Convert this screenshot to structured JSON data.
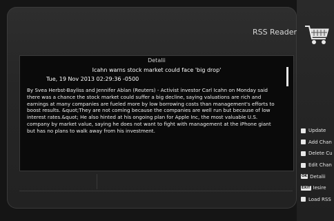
{
  "app": {
    "title": "RSS Reader"
  },
  "detail": {
    "header": "Detalii",
    "headline": "Icahn warns stock market could face 'big drop'",
    "date": "Tue, 19 Nov 2013 02:29:36 -0500",
    "body_lines": [
      "By Svea Herbst-Bayliss and Jennifer Ablan (Reuters) - Activist investor Carl Icahn on Monday said",
      "there was a chance the stock market could suffer a big decline, saying valuations are rich and",
      "earnings at many companies are fueled more by low borrowing costs than management's efforts to",
      "boost results. &quot;They are not coming because the companies are well run but because of low",
      "interest rates.&quot; He also hinted at his ongoing plan for Apple Inc, the most valuable U.S.",
      "company by market value, saying he does not want to fight with management at the iPhone giant",
      "but has no plans to walk away from his investment."
    ]
  },
  "menu": {
    "items": [
      {
        "key": "square",
        "label": "Update"
      },
      {
        "key": "square",
        "label": "Add Chan"
      },
      {
        "key": "square",
        "label": "Delete Cu"
      },
      {
        "key": "square",
        "label": "Edit Chan"
      },
      {
        "key": "OK",
        "label": "Detalii"
      },
      {
        "key": "EXIT",
        "label": "Iesire"
      },
      {
        "key": "square",
        "label": "Load RSS"
      }
    ]
  },
  "colors": {
    "background": "#151515",
    "panel": "#262626",
    "detail_background": "#0a0a0a",
    "text": "#f2f2f2"
  },
  "icons": {
    "cart": "shopping-cart-icon"
  }
}
